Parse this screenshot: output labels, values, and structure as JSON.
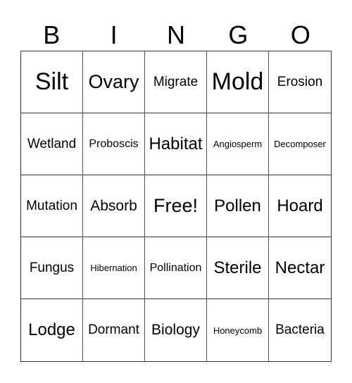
{
  "header": [
    "B",
    "I",
    "N",
    "G",
    "O"
  ],
  "cells": [
    [
      "Silt",
      "Ovary",
      "Migrate",
      "Mold",
      "Erosion"
    ],
    [
      "Wetland",
      "Proboscis",
      "Habitat",
      "Angiosperm",
      "Decomposer"
    ],
    [
      "Mutation",
      "Absorb",
      "Free!",
      "Pollen",
      "Hoard"
    ],
    [
      "Fungus",
      "Hibernation",
      "Pollination",
      "Sterile",
      "Nectar"
    ],
    [
      "Lodge",
      "Dormant",
      "Biology",
      "Honeycomb",
      "Bacteria"
    ]
  ]
}
